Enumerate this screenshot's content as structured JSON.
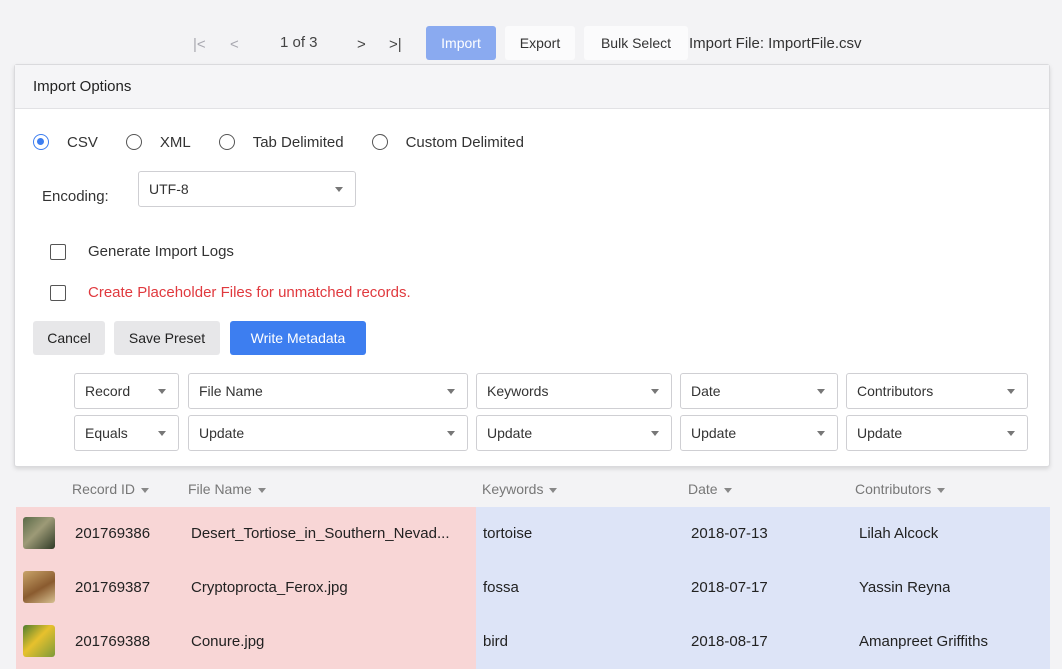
{
  "toolbar": {
    "first_icon": "|<",
    "prev_icon": "<",
    "page_text": "1 of 3",
    "next_icon": ">",
    "last_icon": ">|",
    "import_label": "Import",
    "export_label": "Export",
    "bulk_select_label": "Bulk Select",
    "import_file_text": "Import File: ImportFile.csv"
  },
  "panel": {
    "title": "Import Options",
    "formats": [
      "CSV",
      "XML",
      "Tab Delimited",
      "Custom Delimited"
    ],
    "selected_format": "CSV",
    "encoding_label": "Encoding:",
    "encoding_value": "UTF-8",
    "generate_logs_label": "Generate Import Logs",
    "placeholder_label": "Create Placeholder Files for unmatched records.",
    "cancel_label": "Cancel",
    "save_preset_label": "Save Preset",
    "write_metadata_label": "Write Metadata",
    "mapping_row1": [
      "Record",
      "File Name",
      "Keywords",
      "Date",
      "Contributors"
    ],
    "mapping_row2": [
      "Equals",
      "Update",
      "Update",
      "Update",
      "Update"
    ]
  },
  "table": {
    "headers": [
      "Record ID",
      "File Name",
      "Keywords",
      "Date",
      "Contributors"
    ],
    "rows": [
      {
        "id": "201769386",
        "file": "Desert_Tortiose_in_Southern_Nevad...",
        "keywords": "tortoise",
        "date": "2018-07-13",
        "contributor": "Lilah Alcock"
      },
      {
        "id": "201769387",
        "file": "Cryptoprocta_Ferox.jpg",
        "keywords": "fossa",
        "date": "2018-07-17",
        "contributor": "Yassin Reyna"
      },
      {
        "id": "201769388",
        "file": "Conure.jpg",
        "keywords": "bird",
        "date": "2018-08-17",
        "contributor": "Amanpreet Griffiths"
      }
    ]
  },
  "colors": {
    "accent": "#3d7ef0",
    "import_button": "#8aaaf0",
    "matched_row": "#f8d6d6",
    "update_column": "#dde4f7",
    "warning_text": "#e0393e"
  }
}
